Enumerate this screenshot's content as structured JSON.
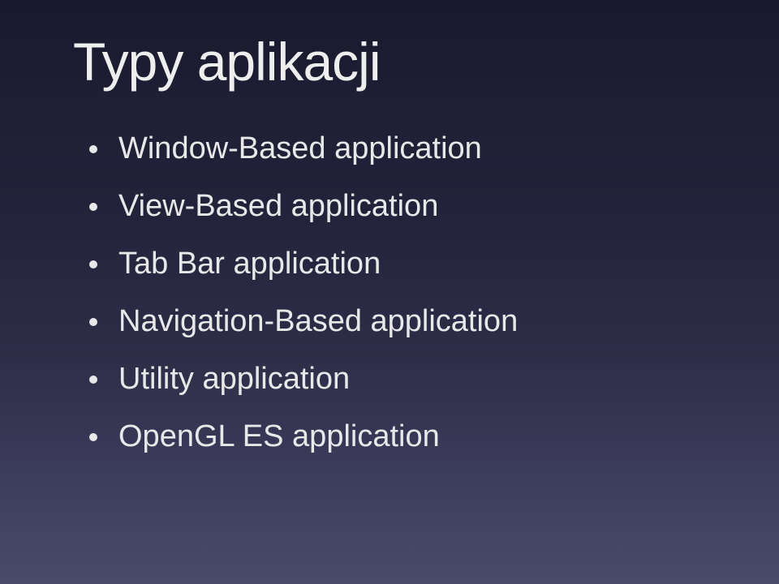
{
  "slide": {
    "title": "Typy aplikacji",
    "bullets": [
      "Window-Based application",
      "View-Based application",
      "Tab Bar application",
      "Navigation-Based application",
      "Utility application",
      "OpenGL ES application"
    ]
  }
}
